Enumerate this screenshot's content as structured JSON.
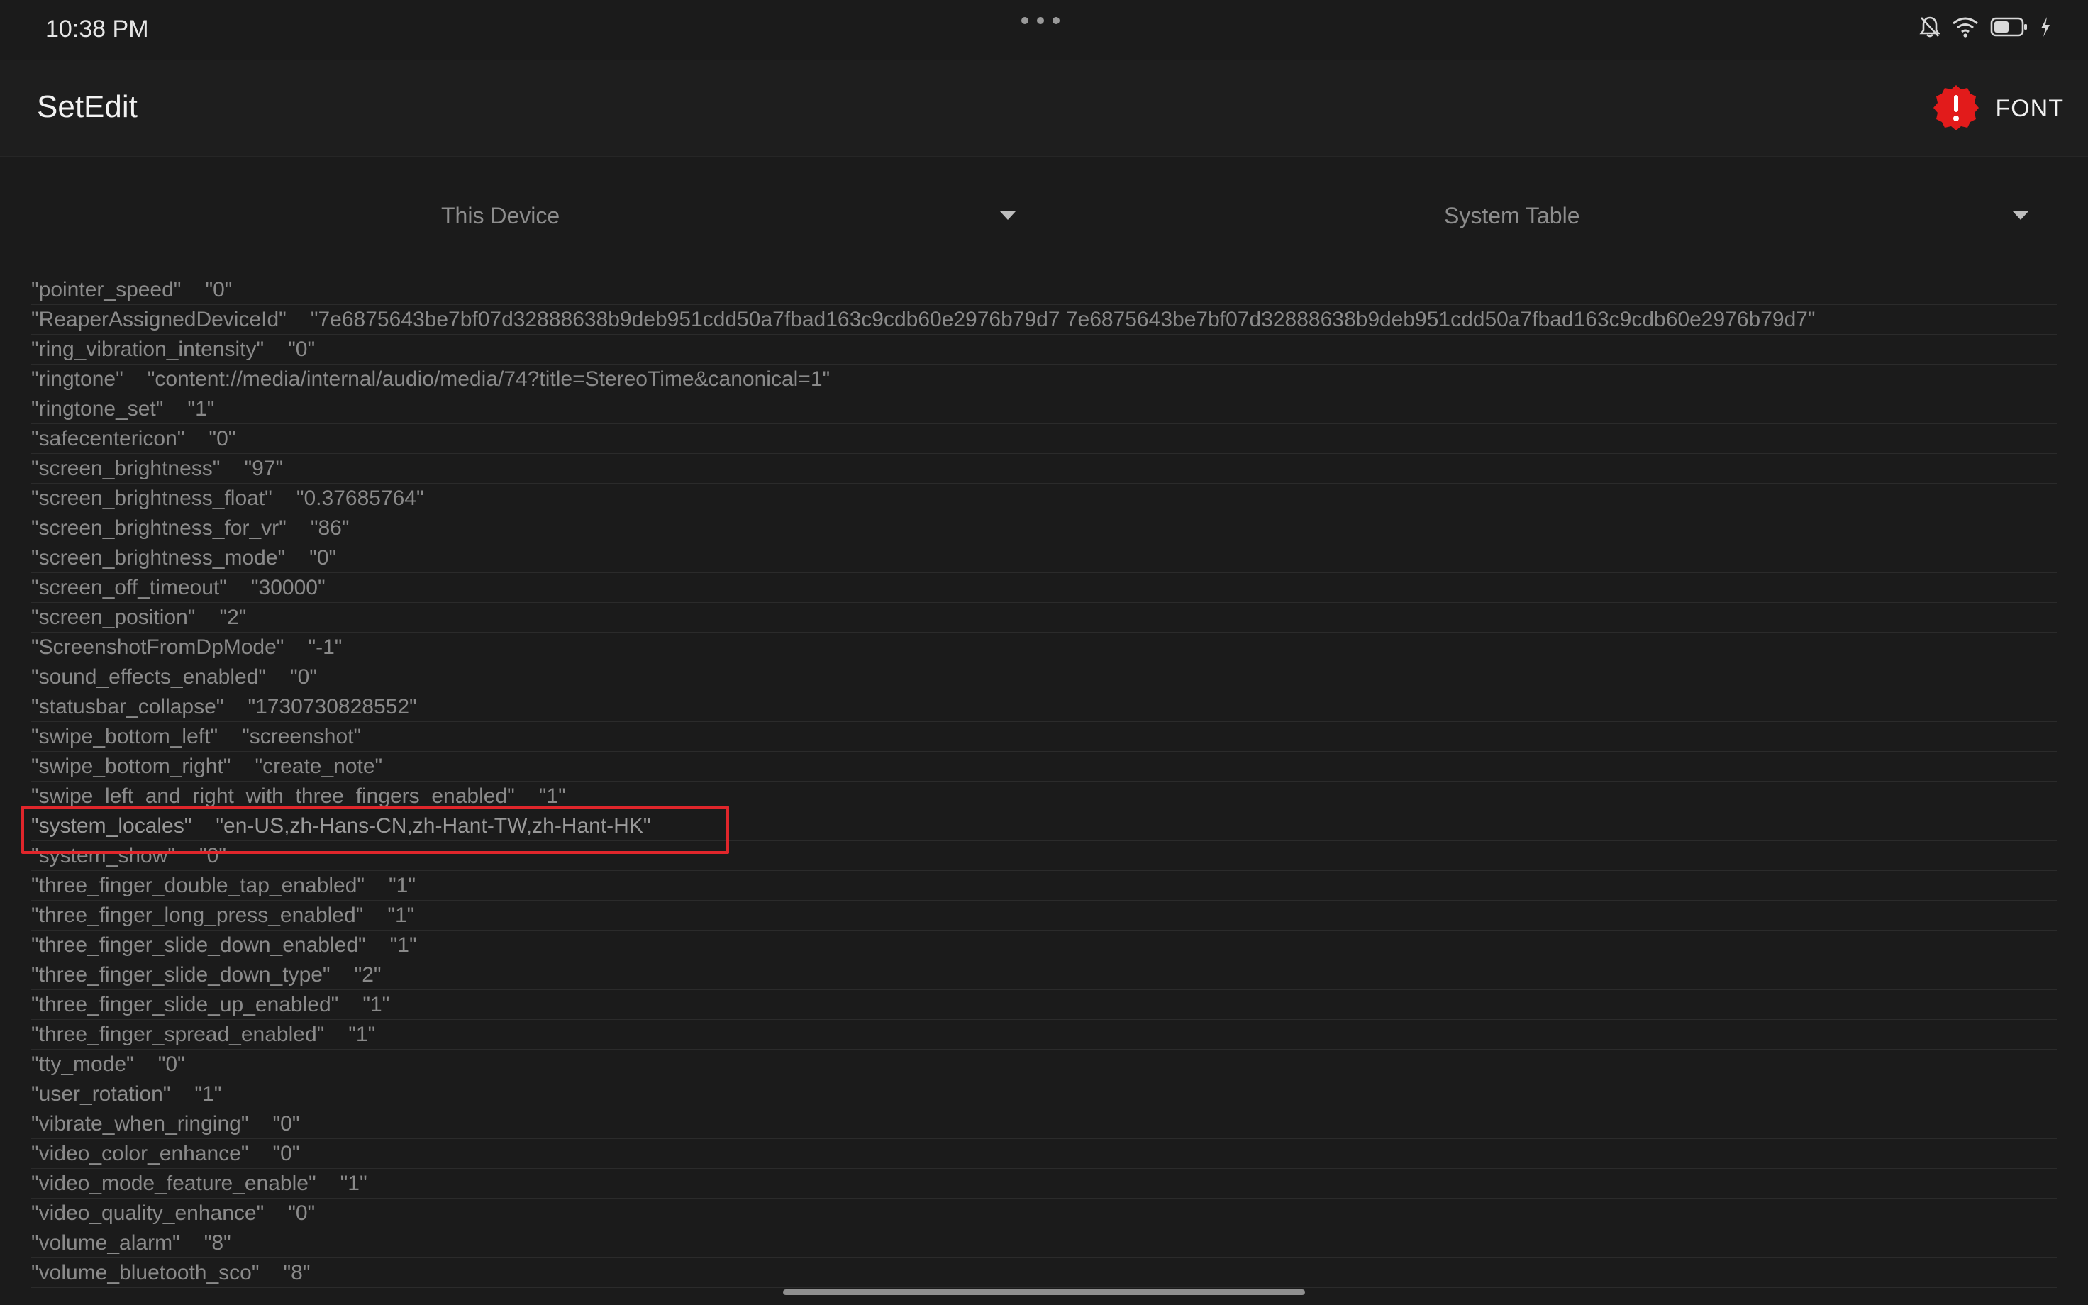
{
  "status": {
    "time": "10:38 PM",
    "icons": [
      "bell-off-icon",
      "wifi-icon",
      "battery-icon",
      "charging-bolt-icon"
    ]
  },
  "appbar": {
    "title": "SetEdit",
    "warning_icon": "alert-badge-icon",
    "font_label": "FONT"
  },
  "filters": {
    "device": "This Device",
    "table": "System Table"
  },
  "rows": [
    {
      "key": "\"pointer_speed\"",
      "value": "\"0\""
    },
    {
      "key": "\"ReaperAssignedDeviceId\"",
      "value": "\"7e6875643be7bf07d32888638b9deb951cdd50a7fbad163c9cdb60e2976b79d7 7e6875643be7bf07d32888638b9deb951cdd50a7fbad163c9cdb60e2976b79d7\""
    },
    {
      "key": "\"ring_vibration_intensity\"",
      "value": "\"0\""
    },
    {
      "key": "\"ringtone\"",
      "value": "\"content://media/internal/audio/media/74?title=StereoTime&canonical=1\""
    },
    {
      "key": "\"ringtone_set\"",
      "value": "\"1\""
    },
    {
      "key": "\"safecentericon\"",
      "value": "\"0\""
    },
    {
      "key": "\"screen_brightness\"",
      "value": "\"97\""
    },
    {
      "key": "\"screen_brightness_float\"",
      "value": "\"0.37685764\""
    },
    {
      "key": "\"screen_brightness_for_vr\"",
      "value": "\"86\""
    },
    {
      "key": "\"screen_brightness_mode\"",
      "value": "\"0\""
    },
    {
      "key": "\"screen_off_timeout\"",
      "value": "\"30000\""
    },
    {
      "key": "\"screen_position\"",
      "value": "\"2\""
    },
    {
      "key": "\"ScreenshotFromDpMode\"",
      "value": "\"-1\""
    },
    {
      "key": "\"sound_effects_enabled\"",
      "value": "\"0\""
    },
    {
      "key": "\"statusbar_collapse\"",
      "value": "\"1730730828552\""
    },
    {
      "key": "\"swipe_bottom_left\"",
      "value": "\"screenshot\""
    },
    {
      "key": "\"swipe_bottom_right\"",
      "value": "\"create_note\""
    },
    {
      "key": "\"swipe_left_and_right_with_three_fingers_enabled\"",
      "value": "\"1\""
    },
    {
      "key": "\"system_locales\"",
      "value": "\"en-US,zh-Hans-CN,zh-Hant-TW,zh-Hant-HK\""
    },
    {
      "key": "\"system_show\"",
      "value": "\"0\""
    },
    {
      "key": "\"three_finger_double_tap_enabled\"",
      "value": "\"1\""
    },
    {
      "key": "\"three_finger_long_press_enabled\"",
      "value": "\"1\""
    },
    {
      "key": "\"three_finger_slide_down_enabled\"",
      "value": "\"1\""
    },
    {
      "key": "\"three_finger_slide_down_type\"",
      "value": "\"2\""
    },
    {
      "key": "\"three_finger_slide_up_enabled\"",
      "value": "\"1\""
    },
    {
      "key": "\"three_finger_spread_enabled\"",
      "value": "\"1\""
    },
    {
      "key": "\"tty_mode\"",
      "value": "\"0\""
    },
    {
      "key": "\"user_rotation\"",
      "value": "\"1\""
    },
    {
      "key": "\"vibrate_when_ringing\"",
      "value": "\"0\""
    },
    {
      "key": "\"video_color_enhance\"",
      "value": "\"0\""
    },
    {
      "key": "\"video_mode_feature_enable\"",
      "value": "\"1\""
    },
    {
      "key": "\"video_quality_enhance\"",
      "value": "\"0\""
    },
    {
      "key": "\"volume_alarm\"",
      "value": "\"8\""
    },
    {
      "key": "\"volume_bluetooth_sco\"",
      "value": "\"8\""
    }
  ],
  "colors": {
    "background": "#1b1b1b",
    "highlight_border": "#e0262b",
    "warning_badge": "#e21b1b"
  }
}
